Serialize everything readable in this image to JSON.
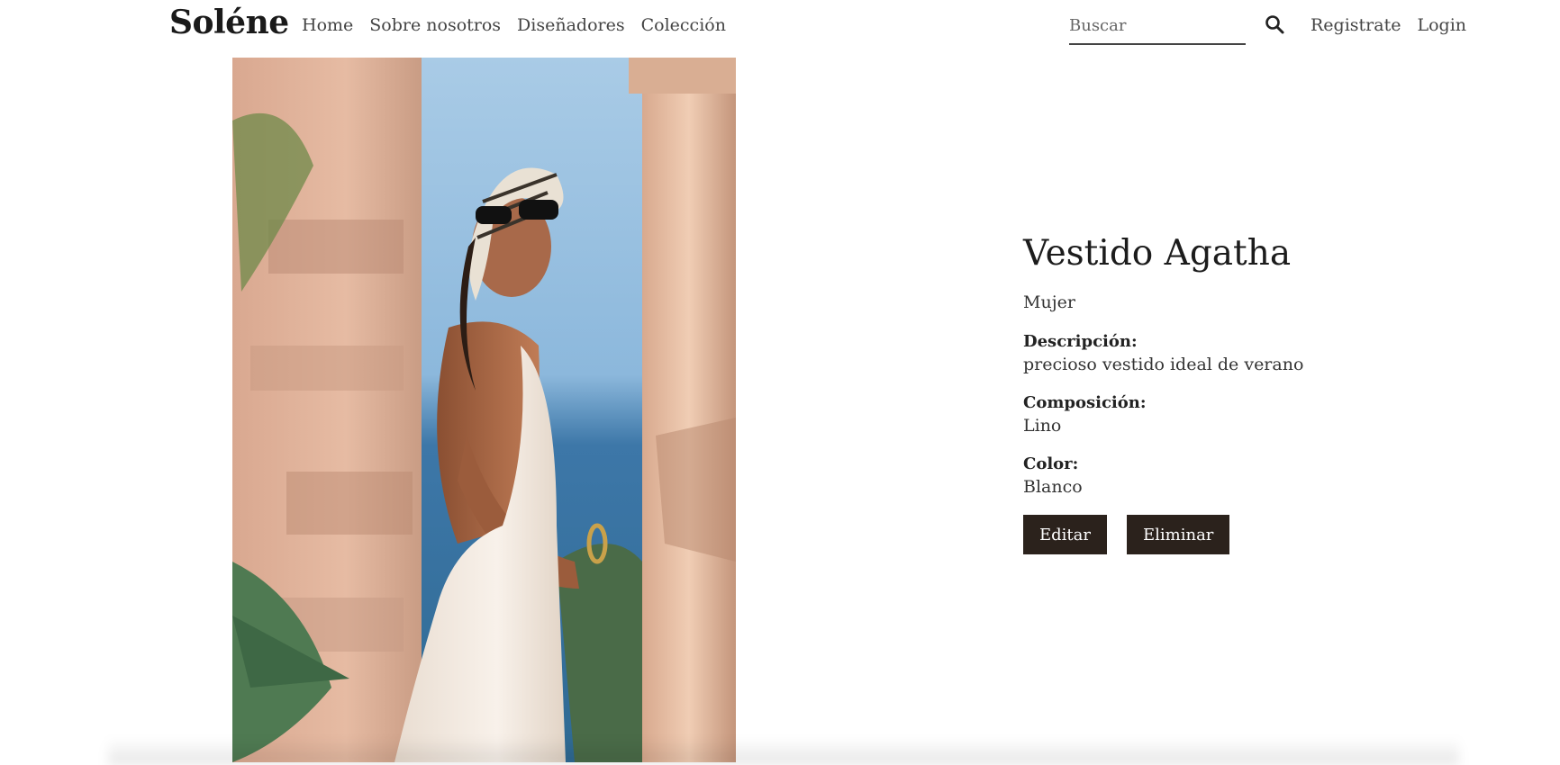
{
  "header": {
    "logo": "Soléne",
    "nav": [
      {
        "label": "Home"
      },
      {
        "label": "Sobre nosotros"
      },
      {
        "label": "Diseñadores"
      },
      {
        "label": "Colección"
      }
    ],
    "search": {
      "placeholder": "Buscar",
      "value": "",
      "icon": "search-icon"
    },
    "auth": {
      "register_label": "Registrate",
      "login_label": "Login"
    }
  },
  "product": {
    "image_alt": "Modelo con vestido blanco y pañuelo en la cabeza",
    "title": "Vestido Agatha",
    "category": "Mujer",
    "description_label": "Descripción:",
    "description": "precioso vestido ideal de verano",
    "composition_label": "Composición:",
    "composition": "Lino",
    "color_label": "Color:",
    "color": "Blanco"
  },
  "actions": {
    "edit_label": "Editar",
    "delete_label": "Eliminar"
  },
  "colors": {
    "button_bg": "#2b221c",
    "text": "#222222"
  }
}
